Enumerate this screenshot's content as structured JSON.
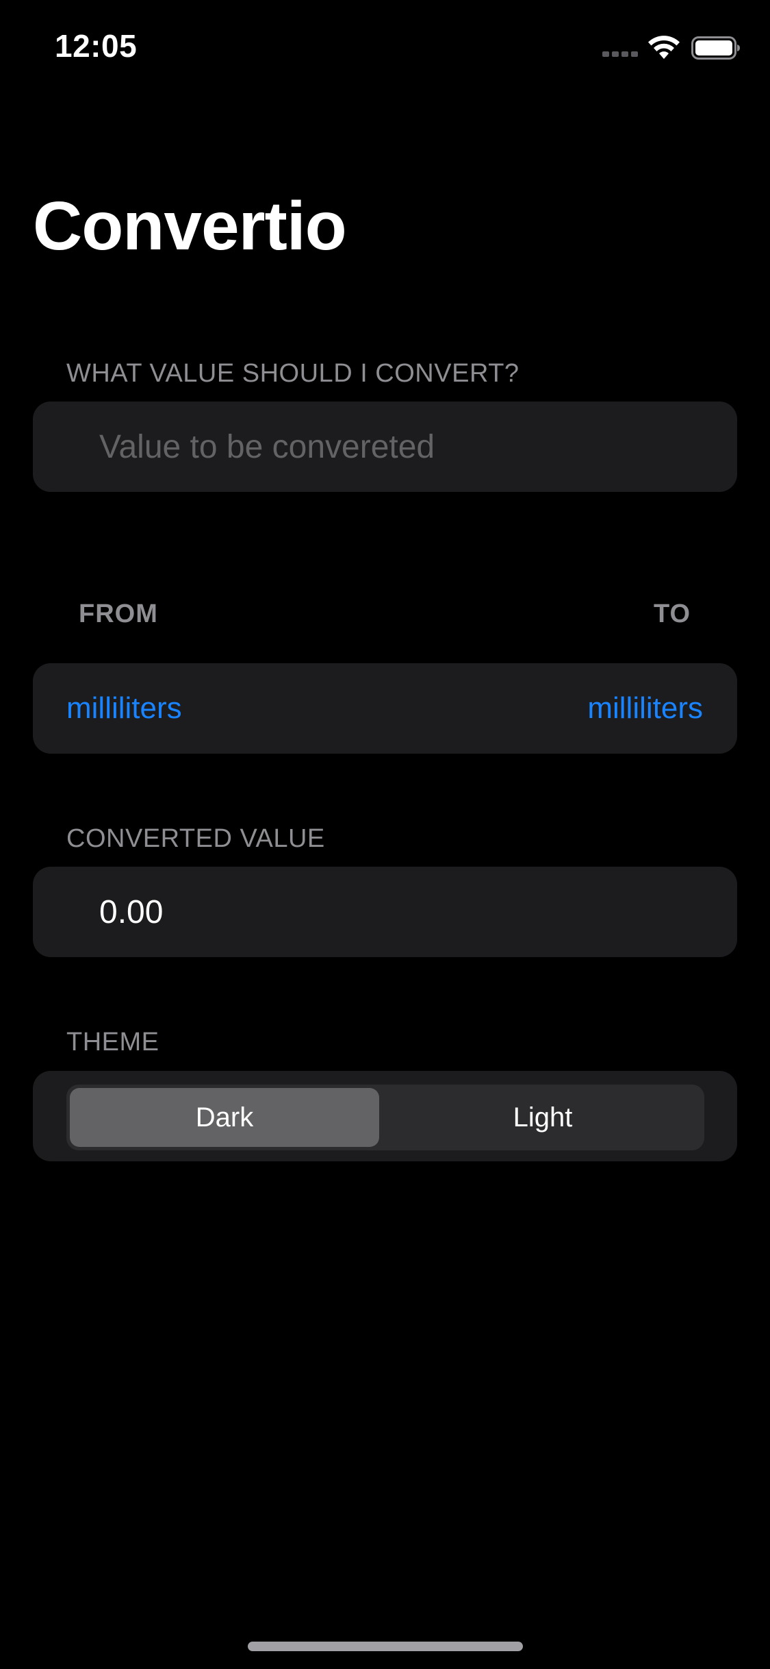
{
  "status_bar": {
    "time": "12:05",
    "signal_icon": "cellular-signal-icon",
    "wifi_icon": "wifi-icon",
    "battery_icon": "battery-full-icon"
  },
  "title": "Convertio",
  "input_section": {
    "header": "WHAT VALUE SHOULD I CONVERT?",
    "value": "",
    "placeholder": "Value to be convereted"
  },
  "units_section": {
    "from_header": "FROM",
    "to_header": "TO",
    "from_unit": "milliliters",
    "to_unit": "milliliters"
  },
  "converted_section": {
    "header": "CONVERTED VALUE",
    "value": "0.00"
  },
  "theme_section": {
    "header": "THEME",
    "options": [
      "Dark",
      "Light"
    ],
    "selected": "Dark"
  },
  "colors": {
    "background": "#000000",
    "card": "#1c1c1e",
    "accent": "#1a84ff",
    "secondary_text": "#8e8e93",
    "placeholder_text": "#636366",
    "segment_selected": "#636366"
  }
}
